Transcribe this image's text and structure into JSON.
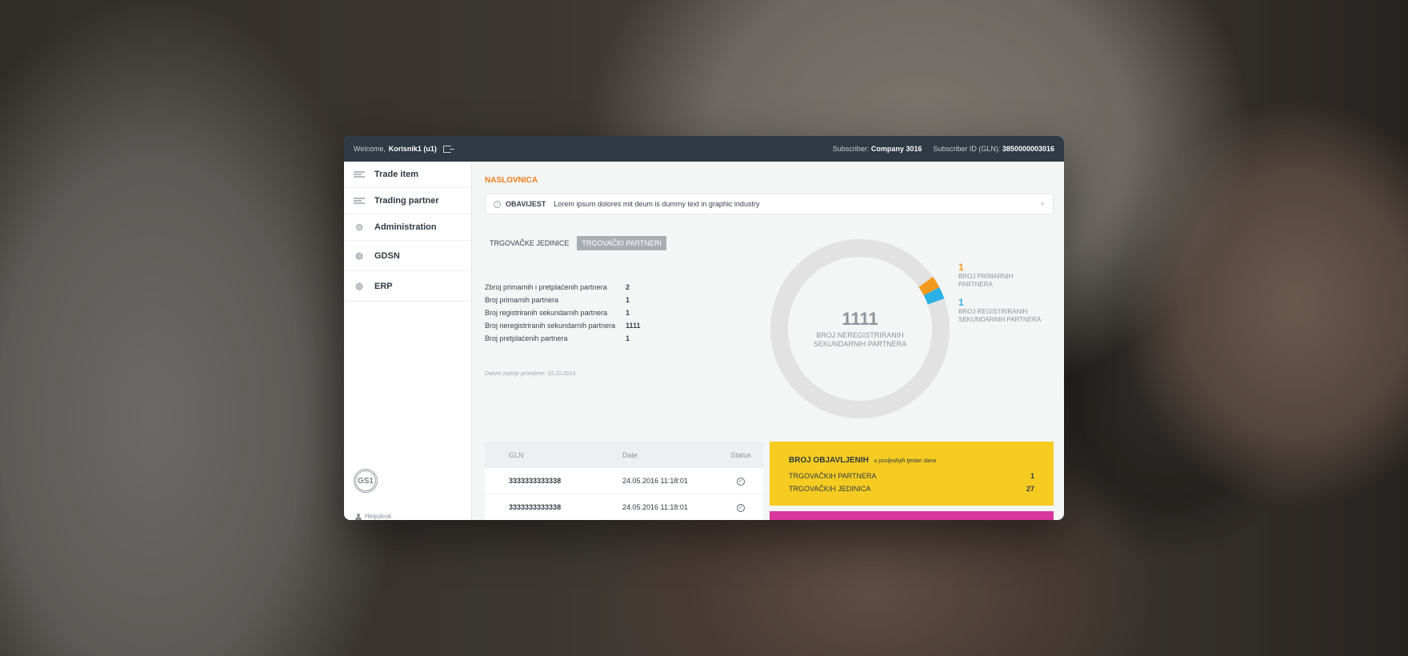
{
  "topbar": {
    "welcome_label": "Welcome,",
    "user": "Korisnik1 (u1)",
    "subscriber_label": "Subscriber:",
    "subscriber_value": "Company 3016",
    "subscriber_id_label": "Subscriber ID (GLN):",
    "subscriber_id_value": "3850000003016"
  },
  "sidebar": {
    "items": [
      {
        "label": "Trade item",
        "icon": "list-icon"
      },
      {
        "label": "Trading partner",
        "icon": "list-icon"
      },
      {
        "label": "Administration",
        "icon": "gear-icon"
      },
      {
        "label": "GDSN",
        "icon": "globe-icon"
      },
      {
        "label": "ERP",
        "icon": "globe-icon"
      }
    ],
    "logo": "GS1",
    "helpdesk": "Helpdesk"
  },
  "main": {
    "title": "NASLOVNICA",
    "notice": {
      "label": "OBAVIJEST",
      "text": "Lorem ipsum dolores mit deum is dummy text in graphic industry",
      "close": "×"
    },
    "tabs": [
      {
        "label": "TRGOVAČKE JEDINICE",
        "active": false
      },
      {
        "label": "TRGOVAČKI PARTNERI",
        "active": true
      }
    ],
    "stats": [
      {
        "label": "Zbroj primarnih i pretplaćenih partnera",
        "value": "2"
      },
      {
        "label": "Broj primarnih partnera",
        "value": "1"
      },
      {
        "label": "Broj registriranih sekundarnih partnera",
        "value": "1"
      },
      {
        "label": "Broj neregistriranih sekundarnih partnera",
        "value": "1111"
      },
      {
        "label": "Broj pretplaćenih partnera",
        "value": "1"
      }
    ],
    "date_note": "Datum zadnje promjene: 10.10.2016.",
    "donut": {
      "center_value": "1111",
      "center_label_1": "BROJ NEREGISTRIRANIH",
      "center_label_2": "SEKUNDARNIH PARTNERA",
      "legend": [
        {
          "value": "1",
          "label_1": "BROJ PRIMARNIH",
          "label_2": "PARTNERA",
          "color": "#f39a1e"
        },
        {
          "value": "1",
          "label_1": "BROJ REGISTRIRANIH",
          "label_2": "SEKUNDARNIH PARTNERA",
          "color": "#2bb1e6"
        }
      ]
    },
    "table": {
      "headers": [
        "GLN",
        "Date",
        "Status"
      ],
      "rows": [
        {
          "gln": "3333333333338",
          "date": "24.05.2016 11:18:01"
        },
        {
          "gln": "3333333333338",
          "date": "24.05.2016 11:18:01"
        }
      ]
    },
    "card": {
      "title": "BROJ OBJAVLJENIH",
      "subtitle": "u posljednjih tjedan dana",
      "rows": [
        {
          "label": "TRGOVAČKIH PARTNERA",
          "value": "1"
        },
        {
          "label": "TRGOVAČKIH JEDINICA",
          "value": "27"
        }
      ]
    }
  },
  "chart_data": {
    "type": "pie",
    "categories": [
      "BROJ NEREGISTRIRANIH SEKUNDARNIH PARTNERA",
      "BROJ PRIMARNIH PARTNERA",
      "BROJ REGISTRIRANIH SEKUNDARNIH PARTNERA"
    ],
    "values": [
      1111,
      1,
      1
    ],
    "colors": [
      "#e2e2e2",
      "#f39a1e",
      "#2bb1e6"
    ]
  }
}
